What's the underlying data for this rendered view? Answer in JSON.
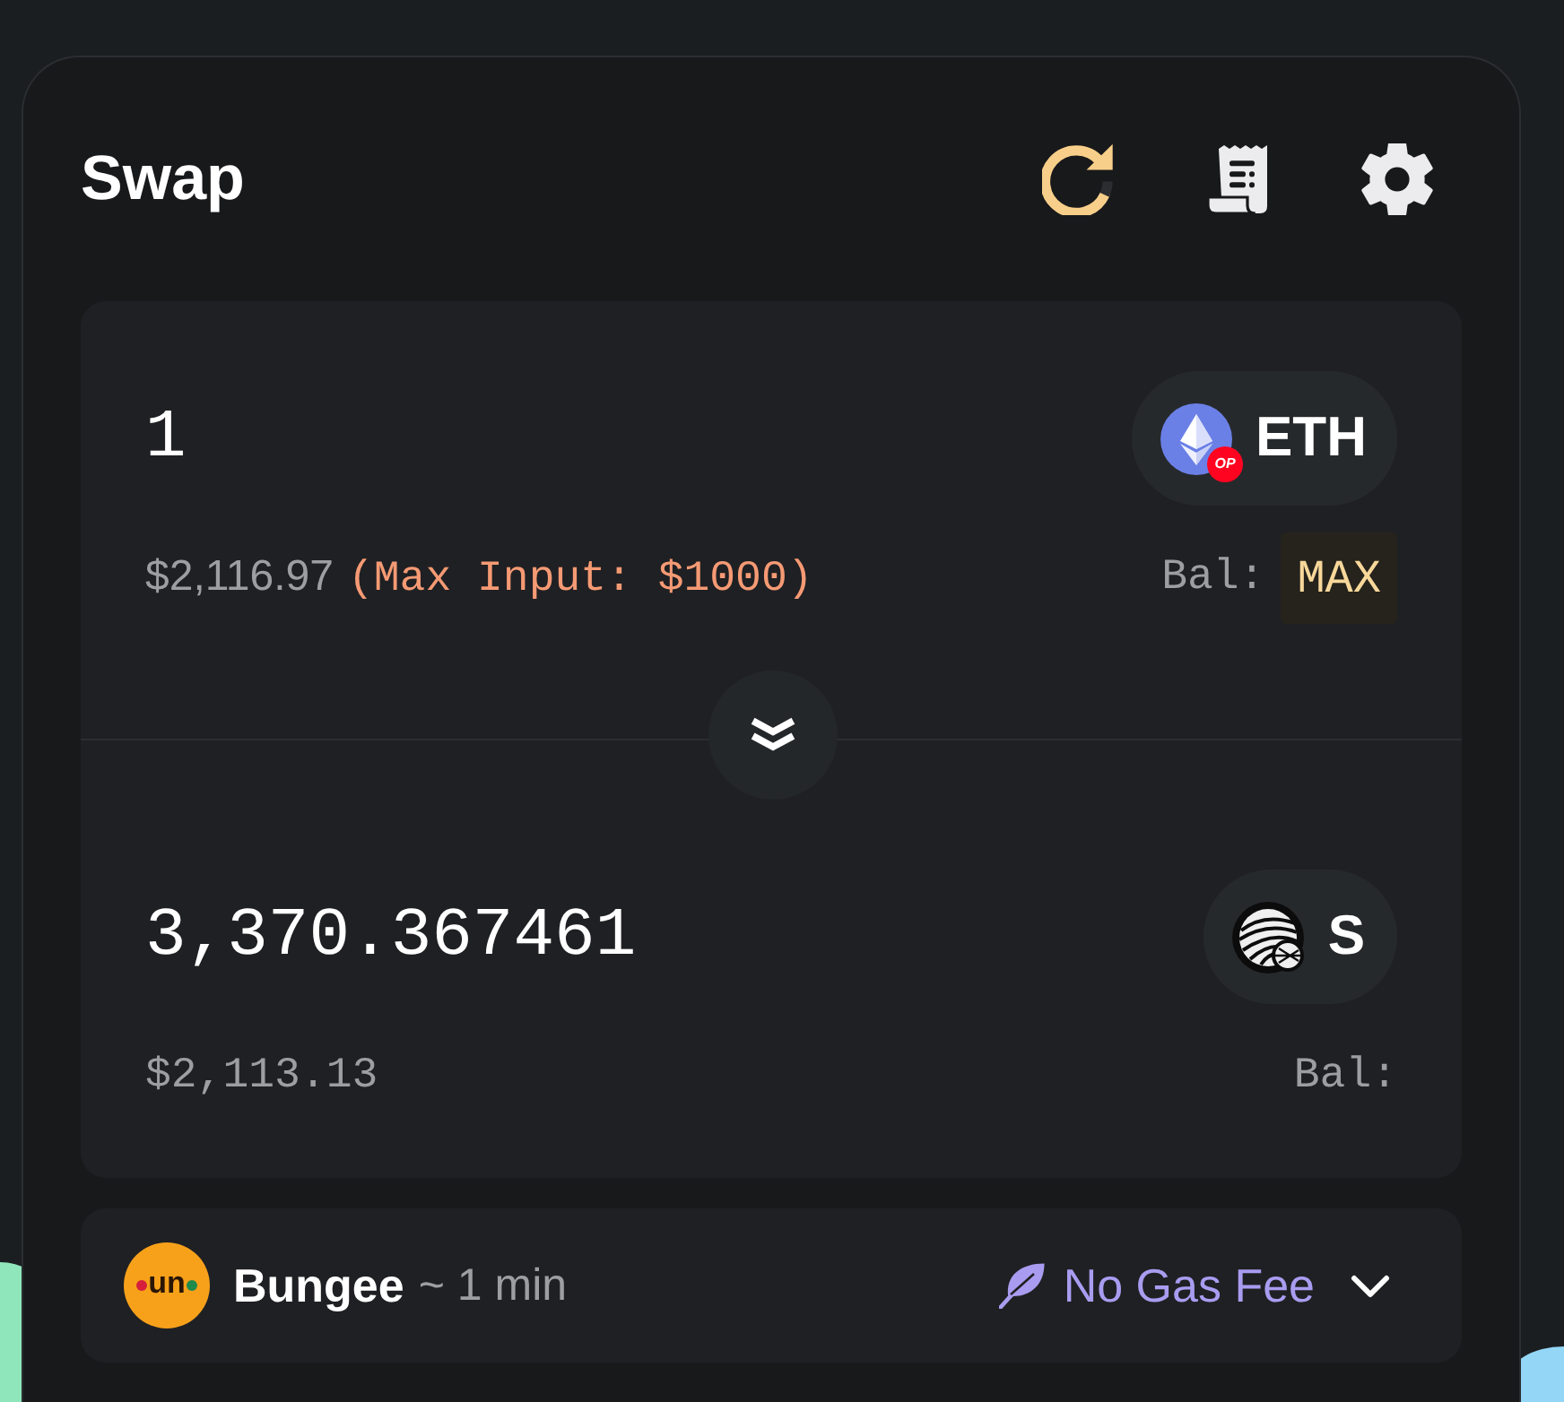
{
  "header": {
    "title": "Swap"
  },
  "tokens": [
    {
      "kind": "pay",
      "amount": "1",
      "symbol": "ETH",
      "chain_badge": "OP",
      "usd_value": "$2,116.97",
      "warning": "(Max Input: $1000)",
      "balance_label": "Bal:",
      "max_label": "MAX"
    },
    {
      "kind": "receive",
      "amount": "3,370.367461",
      "symbol": "S",
      "usd_value": "$2,113.13",
      "balance_label": "Bal:"
    }
  ],
  "route": {
    "logo_text": "un",
    "provider": "Bungee",
    "eta": "~ 1 min",
    "fee_label": "No Gas Fee",
    "expanded": false
  }
}
